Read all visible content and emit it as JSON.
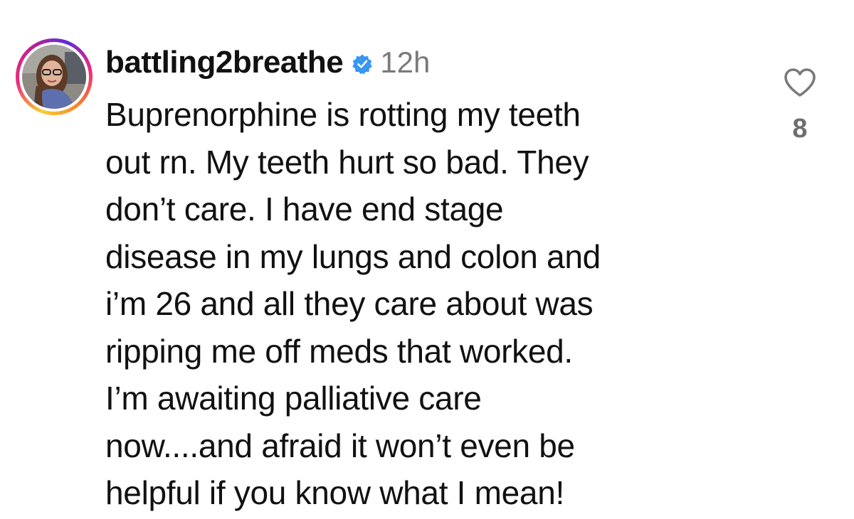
{
  "comment": {
    "username": "battling2breathe",
    "verified_icon": "verified-badge-icon",
    "timestamp": "12h",
    "text_lines": [
      "Buprenorphine is rotting my teeth",
      "out rn. My teeth hurt so bad. They",
      "don’t care. I have end stage",
      "disease in my lungs and colon and",
      "i’m 26 and all they care about was",
      "ripping me off meds that worked.",
      "I’m awaiting palliative care",
      "now....and afraid it won’t even be",
      "helpful if you know what I mean!"
    ],
    "like_icon": "heart-outline-icon",
    "like_count": "8"
  },
  "colors": {
    "text": "#111111",
    "timestamp": "#7a7a7a",
    "like_count": "#6f6f6f",
    "verified": "#3897f0",
    "avatar_ring": [
      "#f9ce34",
      "#ee2a7b",
      "#6228d7"
    ]
  }
}
